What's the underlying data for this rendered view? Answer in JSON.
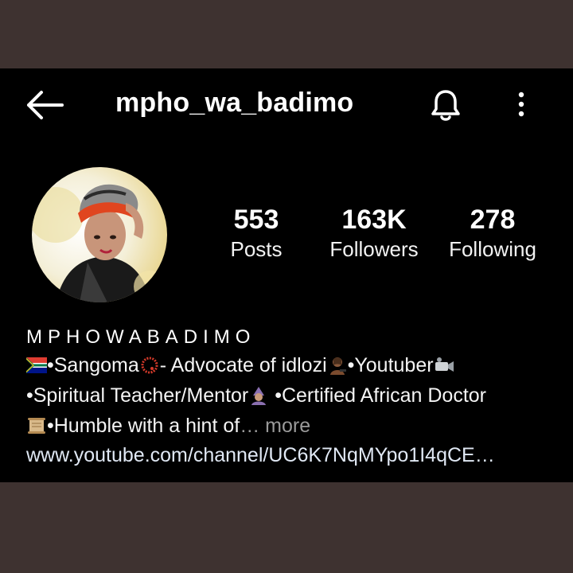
{
  "header": {
    "username": "mpho_wa_badimo",
    "back_icon": "arrow-left-icon",
    "notification_icon": "bell-icon",
    "more_icon": "more-vertical-icon"
  },
  "stats": [
    {
      "value": "553",
      "label": "Posts"
    },
    {
      "value": "163K",
      "label": "Followers"
    },
    {
      "value": "278",
      "label": "Following"
    }
  ],
  "profile": {
    "display_name": "MPHOWABADIMO",
    "bio": {
      "line1_a": "•Sangoma",
      "line1_b": "- Advocate of idlozi",
      "line1_c": "•Youtuber",
      "line2_a": "•Spiritual Teacher/Mentor",
      "line2_b": " •Certified African Doctor",
      "line3_a": "•Humble with a hint of",
      "line3_more": "… more"
    },
    "link": "www.youtube.com/channel/UC6K7NqMYpo1I4qCE…"
  },
  "colors": {
    "frame": "#3e3230",
    "background": "#000000",
    "text": "#ffffff",
    "muted": "#9a9a9a"
  }
}
